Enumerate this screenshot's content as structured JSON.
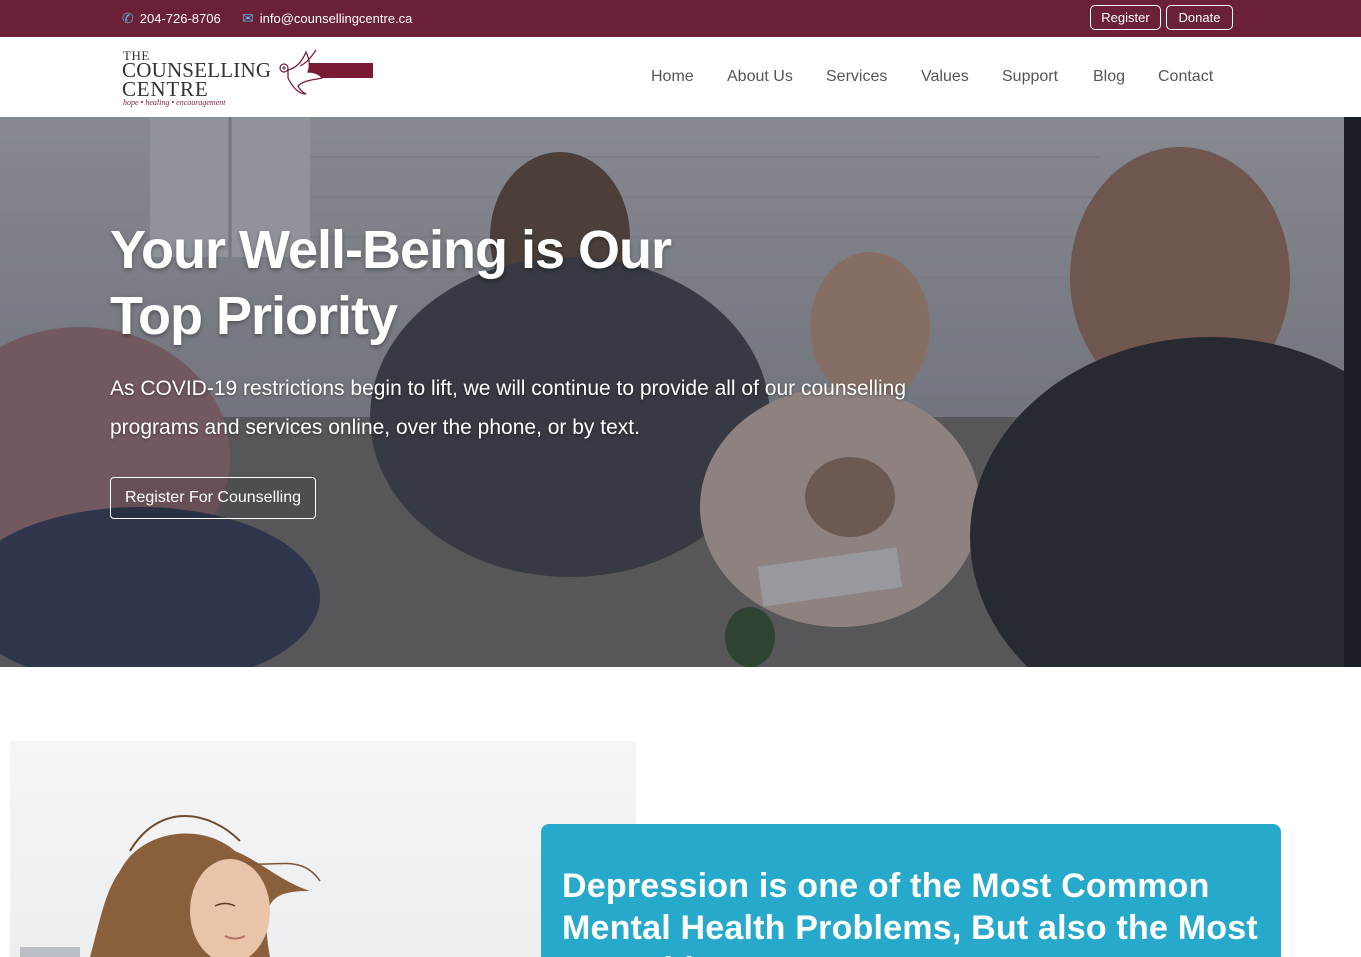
{
  "topbar": {
    "phone": "204-726-8706",
    "email": "info@counsellingcentre.ca",
    "register_label": "Register",
    "donate_label": "Donate",
    "phone_icon": "phone-icon",
    "email_icon": "envelope-icon"
  },
  "logo": {
    "line1": "THE",
    "line2": "COUNSELLING",
    "line3": "CENTRE",
    "tagline": "hope • healing • encouragement"
  },
  "nav": {
    "items": [
      "Home",
      "About Us",
      "Services",
      "Values",
      "Support",
      "Blog",
      "Contact"
    ]
  },
  "hero": {
    "title": "Your Well-Being is Our Top Priority",
    "text": "As COVID-19 restrictions begin to lift, we will continue to provide all of our counselling programs and services online, over the phone, or by text.",
    "cta_label": "Register For Counselling"
  },
  "feature": {
    "heading": "Depression is one of the Most Common Mental Health Problems, But also the Most Treatable"
  },
  "colors": {
    "brand": "#6b2135",
    "accent": "#27a9cc",
    "icon": "#5fb0e8"
  }
}
